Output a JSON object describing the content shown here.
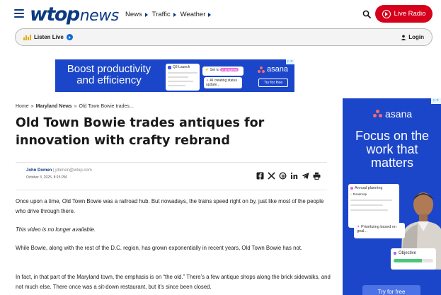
{
  "header": {
    "logo_wtop": "wtop",
    "logo_news": "news",
    "nav": [
      {
        "label": "News"
      },
      {
        "label": "Traffic"
      },
      {
        "label": "Weather"
      }
    ],
    "live_radio_label": "Live Radio"
  },
  "listen_bar": {
    "listen_label": "Listen Live",
    "login_label": "Login"
  },
  "banner_ad": {
    "headline": "Boost productivity and efficiency",
    "card_launch": "Q3 Launch",
    "card_set_to": "Set to",
    "card_status_pill": "in progress",
    "card_ai": "AI creating status update...",
    "brand": "asana",
    "cta": "Try for free"
  },
  "article": {
    "breadcrumb": {
      "home": "Home",
      "sep1": "»",
      "section": "Maryland News",
      "sep2": "»",
      "current": "Old Town Bowie trades..."
    },
    "headline": "Old Town Bowie trades antiques for innovation with crafty rebrand",
    "author_name": "John Domen",
    "author_email": "| jdomen@wtop.com",
    "date": "October 3, 2025, 8:25 PM",
    "share_icons": [
      "facebook-icon",
      "x-icon",
      "threads-icon",
      "linkedin-icon",
      "telegram-icon",
      "print-icon"
    ],
    "paragraphs": [
      "Once upon a time, Old Town Bowie was a railroad hub. But nowadays, the trains speed right on by, just like most of the people who drive through there.",
      "This video is no longer available.",
      "While Bowie, along with the rest of the D.C. region, has grown exponentially in recent years, Old Town Bowie has not.",
      "In fact, in that part of the Maryland town, the emphasis is on “the old.” There’s a few antique shops along the brick sidewalks, and not much else. There once was a sit-down restaurant, but it’s since been closed."
    ]
  },
  "side_ad": {
    "brand": "asana",
    "headline": "Focus on the work that matters",
    "plan_title": "Annual planning",
    "plan_row": "Roadmap",
    "prio_text": "Prioritizing based on goal...",
    "objective": "Objective",
    "objective_progress": 0.72,
    "cta": "Try for free"
  },
  "colors": {
    "brand_blue": "#0b3a82",
    "live_red": "#d6001c",
    "ad_blue": "#1c46c9",
    "asana_coral": "#ff6a6a"
  }
}
